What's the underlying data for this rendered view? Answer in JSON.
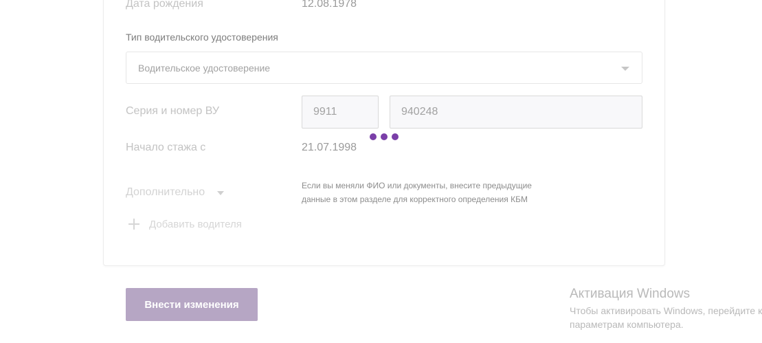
{
  "form": {
    "birth_date_label": "Дата рождения",
    "birth_date_value": "12.08.1978",
    "license_type_title": "Тип водительского удостоверения",
    "license_type_selected": "Водительское удостоверение",
    "license_number_label": "Серия и номер ВУ",
    "license_series": "9911",
    "license_number": "940248",
    "experience_label": "Начало стажа с",
    "experience_value": "21.07.1998",
    "additional_label": "Дополнительно",
    "hint_line1": "Если вы меняли ФИО или документы, внесите предыдущие",
    "hint_line2": "данные в этом разделе для корректного определения КБМ",
    "add_driver_label": "Добавить водителя"
  },
  "actions": {
    "submit_label": "Внести изменения"
  },
  "windows_watermark": {
    "title": "Активация Windows",
    "line1": "Чтобы активировать Windows, перейдите к",
    "line2": "параметрам компьютера."
  },
  "colors": {
    "accent": "#7a3fa8",
    "button": "#b6a6c4"
  },
  "icons": {
    "select_caret": "chevron-down-icon",
    "additional_caret": "chevron-down-icon",
    "add": "plus-icon",
    "loading": "loading-dots-icon"
  }
}
